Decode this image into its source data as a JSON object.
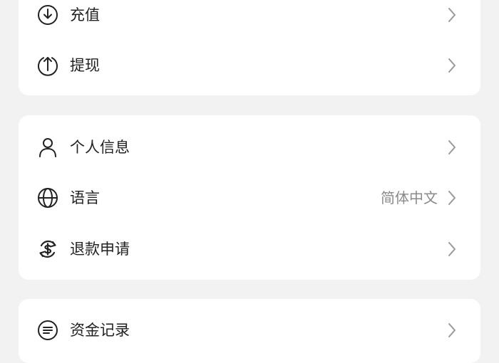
{
  "groups": [
    {
      "items": [
        {
          "label": "充值",
          "icon": "arrow-down-circle-icon"
        },
        {
          "label": "提现",
          "icon": "arrow-up-circle-icon"
        }
      ]
    },
    {
      "items": [
        {
          "label": "个人信息",
          "icon": "user-icon"
        },
        {
          "label": "语言",
          "icon": "globe-icon",
          "value": "简体中文"
        },
        {
          "label": "退款申请",
          "icon": "refund-icon"
        }
      ]
    },
    {
      "items": [
        {
          "label": "资金记录",
          "icon": "funds-record-icon"
        }
      ]
    }
  ],
  "colors": {
    "background": "#f2f2f2",
    "card": "#ffffff",
    "text": "#222222",
    "secondary_text": "#8a8a8a",
    "chevron": "#9a9a9a"
  }
}
